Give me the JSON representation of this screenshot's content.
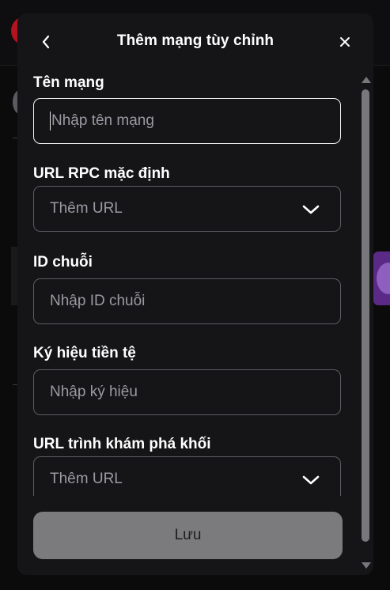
{
  "modal": {
    "title": "Thêm mạng tùy chỉnh",
    "back_icon": "chevron-left-icon",
    "close_icon": "close-icon"
  },
  "form": {
    "network_name": {
      "label": "Tên mạng",
      "placeholder": "Nhập tên mạng"
    },
    "rpc_url": {
      "label": "URL RPC mặc định",
      "placeholder": "Thêm URL",
      "icon": "chevron-down-icon"
    },
    "chain_id": {
      "label": "ID chuỗi",
      "placeholder": "Nhập ID chuỗi"
    },
    "currency_symbol": {
      "label": "Ký hiệu tiền tệ",
      "placeholder": "Nhập ký hiệu"
    },
    "explorer_url": {
      "label": "URL trình khám phá khối",
      "placeholder": "Thêm URL",
      "icon": "chevron-down-icon"
    }
  },
  "footer": {
    "save_label": "Lưu"
  },
  "colors": {
    "modal_bg": "#151517",
    "border": "#5c5c62",
    "button_disabled": "#7b7b7e"
  }
}
